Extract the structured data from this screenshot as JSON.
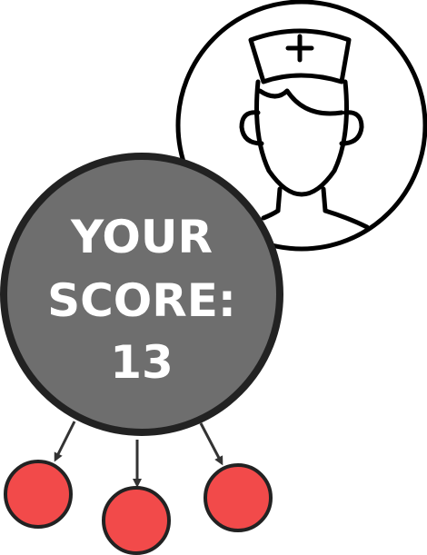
{
  "score_card": {
    "line1": "YOUR",
    "line2": "SCORE:",
    "value": "13"
  },
  "avatar": {
    "icon": "nurse-icon"
  },
  "outcomes": {
    "count": 3,
    "node_icon": "red-circle"
  },
  "colors": {
    "score_fill": "#6e6e6e",
    "outline": "#222222",
    "outcome_fill": "#f24a4a",
    "arrow": "#333333",
    "icon_stroke": "#000000"
  }
}
